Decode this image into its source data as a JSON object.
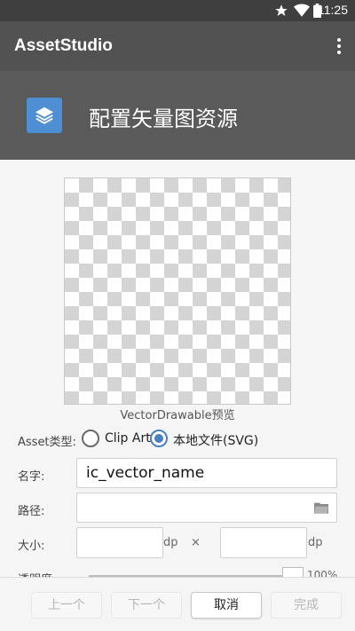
{
  "status_bar": {
    "time": "11:25",
    "icons": [
      "star-icon",
      "wifi-icon",
      "battery-icon"
    ]
  },
  "app_bar": {
    "title": "AssetStudio",
    "overflow_icon": "more-vert-icon"
  },
  "header": {
    "icon": "layers-icon",
    "title": "配置矢量图资源"
  },
  "preview": {
    "label": "VectorDrawable预览"
  },
  "asset_type": {
    "label": "Asset类型:",
    "options": [
      {
        "label": "Clip Art",
        "selected": false
      },
      {
        "label": "本地文件(SVG)",
        "selected": true
      }
    ]
  },
  "name_field": {
    "label": "名字:",
    "value": "ic_vector_name"
  },
  "path_field": {
    "label": "路径:",
    "value": "",
    "icon": "folder-icon"
  },
  "size": {
    "label": "大小:",
    "width": "",
    "height": "",
    "unit": "dp",
    "separator": "×"
  },
  "opacity": {
    "label": "透明度:",
    "value_text": "100%",
    "level": 1.0
  },
  "footer": {
    "prev": "上一个",
    "next": "下一个",
    "cancel": "取消",
    "finish": "完成"
  },
  "colors": {
    "accent": "#4a7fc0",
    "appbar": "#525252",
    "header": "#5a5a5a",
    "logo": "#4e8fd3"
  }
}
